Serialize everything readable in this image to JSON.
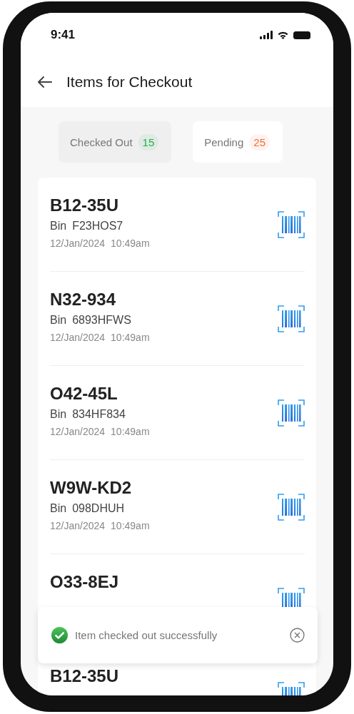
{
  "status_bar": {
    "time": "9:41"
  },
  "header": {
    "title": "Items for Checkout"
  },
  "tabs": [
    {
      "label": "Checked Out",
      "count": "15",
      "selected": false,
      "color": "#22b14c"
    },
    {
      "label": "Pending",
      "count": "25",
      "selected": true,
      "color": "#f26b3a"
    }
  ],
  "items": [
    {
      "code": "B12-35U",
      "bin_label": "Bin",
      "bin": "F23HOS7",
      "date": "12/Jan/2024",
      "time": "10:49am"
    },
    {
      "code": "N32-934",
      "bin_label": "Bin",
      "bin": "6893HFWS",
      "date": "12/Jan/2024",
      "time": "10:49am"
    },
    {
      "code": "O42-45L",
      "bin_label": "Bin",
      "bin": "834HF834",
      "date": "12/Jan/2024",
      "time": "10:49am"
    },
    {
      "code": "W9W-KD2",
      "bin_label": "Bin",
      "bin": "098DHUH",
      "date": "12/Jan/2024",
      "time": "10:49am"
    },
    {
      "code": "O33-8EJ"
    },
    {
      "code": "B12-35U"
    }
  ],
  "toast": {
    "message": "Item checked out successfully"
  }
}
